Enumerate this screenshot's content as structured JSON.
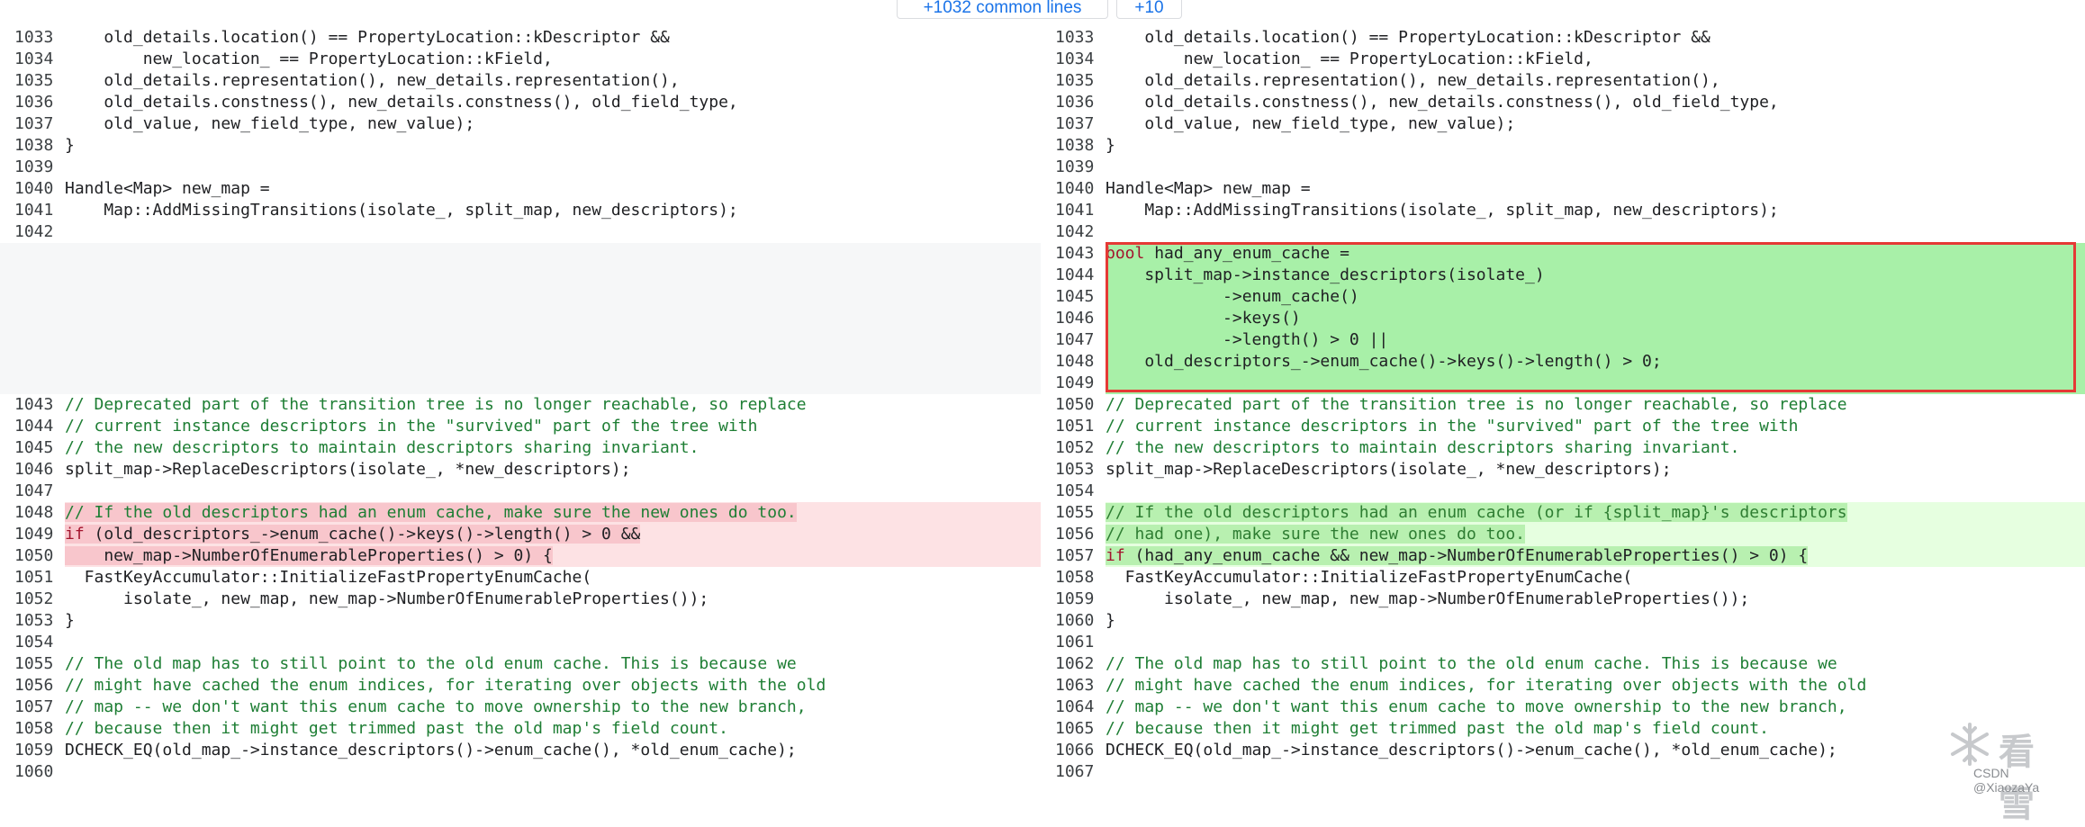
{
  "expand_controls": {
    "common_lines_label": "+1032 common lines",
    "plus_label": "+10"
  },
  "left_pane": {
    "lines": [
      {
        "n": "1033",
        "t": "    old_details.location() == PropertyLocation::kDescriptor &&",
        "k": "n"
      },
      {
        "n": "1034",
        "t": "        new_location_ == PropertyLocation::kField,",
        "k": "n"
      },
      {
        "n": "1035",
        "t": "    old_details.representation(), new_details.representation(),",
        "k": "n"
      },
      {
        "n": "1036",
        "t": "    old_details.constness(), new_details.constness(), old_field_type,",
        "k": "n"
      },
      {
        "n": "1037",
        "t": "    old_value, new_field_type, new_value);",
        "k": "n"
      },
      {
        "n": "1038",
        "t": "}",
        "k": "n"
      },
      {
        "n": "1039",
        "t": "",
        "k": "n"
      },
      {
        "n": "1040",
        "t": "Handle<Map> new_map =",
        "k": "n"
      },
      {
        "n": "1041",
        "t": "    Map::AddMissingTransitions(isolate_, split_map, new_descriptors);",
        "k": "n"
      },
      {
        "n": "1042",
        "t": "",
        "k": "n"
      },
      {
        "n": "",
        "t": "",
        "k": "blank"
      },
      {
        "n": "",
        "t": "",
        "k": "blank"
      },
      {
        "n": "",
        "t": "",
        "k": "blank"
      },
      {
        "n": "",
        "t": "",
        "k": "blank"
      },
      {
        "n": "",
        "t": "",
        "k": "blank"
      },
      {
        "n": "",
        "t": "",
        "k": "blank"
      },
      {
        "n": "",
        "t": "",
        "k": "blank"
      },
      {
        "n": "1043",
        "t": "// Deprecated part of the transition tree is no longer reachable, so replace",
        "k": "c"
      },
      {
        "n": "1044",
        "t": "// current instance descriptors in the \"survived\" part of the tree with",
        "k": "c"
      },
      {
        "n": "1045",
        "t": "// the new descriptors to maintain descriptors sharing invariant.",
        "k": "c"
      },
      {
        "n": "1046",
        "t": "split_map->ReplaceDescriptors(isolate_, *new_descriptors);",
        "k": "n"
      },
      {
        "n": "1047",
        "t": "",
        "k": "n"
      },
      {
        "n": "1048",
        "t": "// If the old descriptors had an enum cache, make sure the new ones do too.",
        "k": "del-c"
      },
      {
        "n": "1049",
        "t": "if (old_descriptors_->enum_cache()->keys()->length() > 0 &&",
        "k": "del-if"
      },
      {
        "n": "1050",
        "t": "    new_map->NumberOfEnumerableProperties() > 0) {",
        "k": "del"
      },
      {
        "n": "1051",
        "t": "  FastKeyAccumulator::InitializeFastPropertyEnumCache(",
        "k": "n"
      },
      {
        "n": "1052",
        "t": "      isolate_, new_map, new_map->NumberOfEnumerableProperties());",
        "k": "n"
      },
      {
        "n": "1053",
        "t": "}",
        "k": "n"
      },
      {
        "n": "1054",
        "t": "",
        "k": "n"
      },
      {
        "n": "1055",
        "t": "// The old map has to still point to the old enum cache. This is because we",
        "k": "c"
      },
      {
        "n": "1056",
        "t": "// might have cached the enum indices, for iterating over objects with the old",
        "k": "c"
      },
      {
        "n": "1057",
        "t": "// map -- we don't want this enum cache to move ownership to the new branch,",
        "k": "c"
      },
      {
        "n": "1058",
        "t": "// because then it might get trimmed past the old map's field count.",
        "k": "c"
      },
      {
        "n": "1059",
        "t": "DCHECK_EQ(old_map_->instance_descriptors()->enum_cache(), *old_enum_cache);",
        "k": "n"
      },
      {
        "n": "1060",
        "t": "",
        "k": "n"
      }
    ]
  },
  "right_pane": {
    "lines": [
      {
        "n": "1033",
        "t": "    old_details.location() == PropertyLocation::kDescriptor &&",
        "k": "n"
      },
      {
        "n": "1034",
        "t": "        new_location_ == PropertyLocation::kField,",
        "k": "n"
      },
      {
        "n": "1035",
        "t": "    old_details.representation(), new_details.representation(),",
        "k": "n"
      },
      {
        "n": "1036",
        "t": "    old_details.constness(), new_details.constness(), old_field_type,",
        "k": "n"
      },
      {
        "n": "1037",
        "t": "    old_value, new_field_type, new_value);",
        "k": "n"
      },
      {
        "n": "1038",
        "t": "}",
        "k": "n"
      },
      {
        "n": "1039",
        "t": "",
        "k": "n"
      },
      {
        "n": "1040",
        "t": "Handle<Map> new_map =",
        "k": "n"
      },
      {
        "n": "1041",
        "t": "    Map::AddMissingTransitions(isolate_, split_map, new_descriptors);",
        "k": "n"
      },
      {
        "n": "1042",
        "t": "",
        "k": "n"
      },
      {
        "n": "1043",
        "t": "bool had_any_enum_cache =",
        "k": "addS-bool"
      },
      {
        "n": "1044",
        "t": "    split_map->instance_descriptors(isolate_)",
        "k": "addS"
      },
      {
        "n": "1045",
        "t": "            ->enum_cache()",
        "k": "addS"
      },
      {
        "n": "1046",
        "t": "            ->keys()",
        "k": "addS"
      },
      {
        "n": "1047",
        "t": "            ->length() > 0 ||",
        "k": "addS"
      },
      {
        "n": "1048",
        "t": "    old_descriptors_->enum_cache()->keys()->length() > 0;",
        "k": "addS"
      },
      {
        "n": "1049",
        "t": "",
        "k": "addS"
      },
      {
        "n": "1050",
        "t": "// Deprecated part of the transition tree is no longer reachable, so replace",
        "k": "c"
      },
      {
        "n": "1051",
        "t": "// current instance descriptors in the \"survived\" part of the tree with",
        "k": "c"
      },
      {
        "n": "1052",
        "t": "// the new descriptors to maintain descriptors sharing invariant.",
        "k": "c"
      },
      {
        "n": "1053",
        "t": "split_map->ReplaceDescriptors(isolate_, *new_descriptors);",
        "k": "n"
      },
      {
        "n": "1054",
        "t": "",
        "k": "n"
      },
      {
        "n": "1055",
        "t": "// If the old descriptors had an enum cache (or if {split_map}'s descriptors",
        "k": "add-c"
      },
      {
        "n": "1056",
        "t": "// had one), make sure the new ones do too.",
        "k": "add-c"
      },
      {
        "n": "1057",
        "t": "if (had_any_enum_cache && new_map->NumberOfEnumerableProperties() > 0) {",
        "k": "add-if"
      },
      {
        "n": "1058",
        "t": "  FastKeyAccumulator::InitializeFastPropertyEnumCache(",
        "k": "n"
      },
      {
        "n": "1059",
        "t": "      isolate_, new_map, new_map->NumberOfEnumerableProperties());",
        "k": "n"
      },
      {
        "n": "1060",
        "t": "}",
        "k": "n"
      },
      {
        "n": "1061",
        "t": "",
        "k": "n"
      },
      {
        "n": "1062",
        "t": "// The old map has to still point to the old enum cache. This is because we",
        "k": "c"
      },
      {
        "n": "1063",
        "t": "// might have cached the enum indices, for iterating over objects with the old",
        "k": "c"
      },
      {
        "n": "1064",
        "t": "// map -- we don't want this enum cache to move ownership to the new branch,",
        "k": "c"
      },
      {
        "n": "1065",
        "t": "// because then it might get trimmed past the old map's field count.",
        "k": "c"
      },
      {
        "n": "1066",
        "t": "DCHECK_EQ(old_map_->instance_descriptors()->enum_cache(), *old_enum_cache);",
        "k": "n"
      },
      {
        "n": "1067",
        "t": "",
        "k": "n"
      }
    ]
  },
  "watermark": {
    "brand": "看雪",
    "sub": "CSDN @XiaozaYa"
  },
  "colors": {
    "deleted_bg": "#fde2e4",
    "added_bg": "#e6ffe0",
    "added_strong_bg": "#a8f0a8",
    "focus_border": "#e53935",
    "link_blue": "#1a73e8"
  }
}
